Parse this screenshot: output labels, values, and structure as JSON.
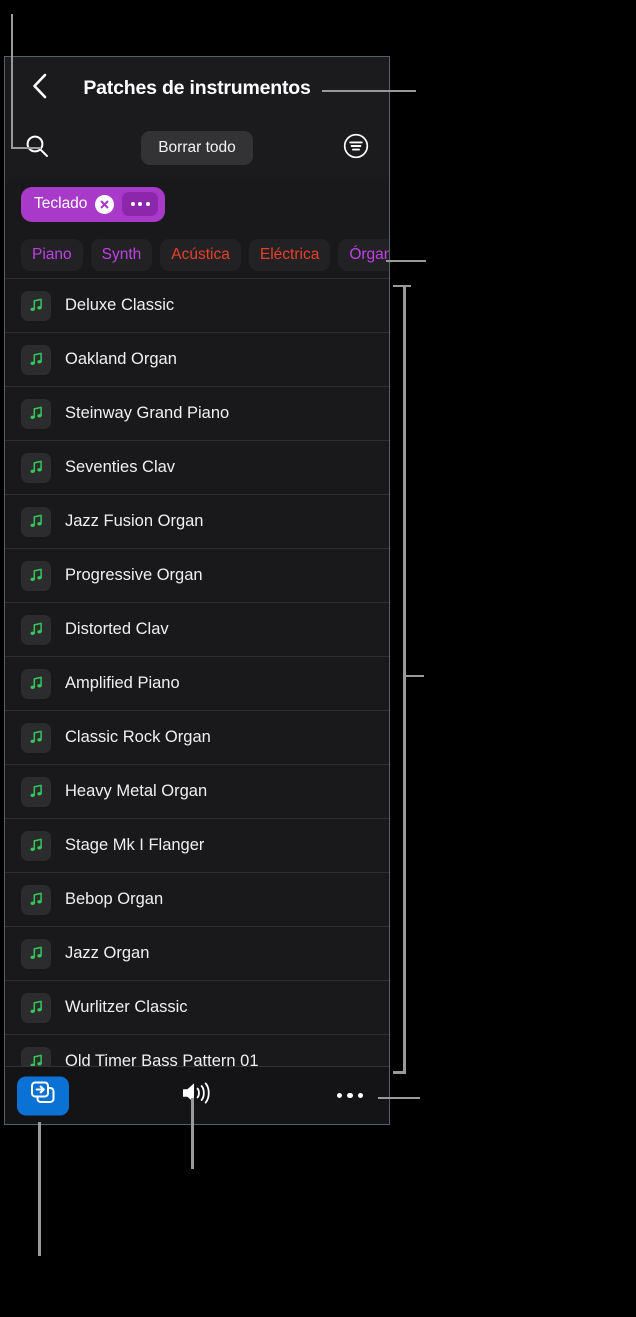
{
  "panel": {
    "title": "Patches de instrumentos",
    "back_icon": "chevron-left-icon"
  },
  "search_row": {
    "search_icon": "search-icon",
    "clear_all_label": "Borrar todo",
    "filter_icon": "filter-sort-icon"
  },
  "selected_tokens": [
    {
      "label": "Teclado",
      "remove_icon": "close-circle-icon",
      "more_icon": "ellipsis-icon",
      "color": "#A839C9",
      "more_color": "#8C27AB"
    }
  ],
  "category_chips": [
    {
      "label": "Piano",
      "color": "#C040E8"
    },
    {
      "label": "Synth",
      "color": "#C040E8"
    },
    {
      "label": "Acústica",
      "color": "#E8402A"
    },
    {
      "label": "Eléctrica",
      "color": "#E8402A"
    },
    {
      "label": "Órgano",
      "color": "#C040E8"
    }
  ],
  "patches": [
    {
      "name": "Deluxe Classic",
      "icon": "music-note-icon"
    },
    {
      "name": "Oakland Organ",
      "icon": "music-note-icon"
    },
    {
      "name": "Steinway Grand Piano",
      "icon": "music-note-icon"
    },
    {
      "name": "Seventies Clav",
      "icon": "music-note-icon"
    },
    {
      "name": "Jazz Fusion Organ",
      "icon": "music-note-icon"
    },
    {
      "name": "Progressive Organ",
      "icon": "music-note-icon"
    },
    {
      "name": "Distorted Clav",
      "icon": "music-note-icon"
    },
    {
      "name": "Amplified Piano",
      "icon": "music-note-icon"
    },
    {
      "name": "Classic Rock Organ",
      "icon": "music-note-icon"
    },
    {
      "name": "Heavy Metal Organ",
      "icon": "music-note-icon"
    },
    {
      "name": "Stage Mk I Flanger",
      "icon": "music-note-icon"
    },
    {
      "name": "Bebop Organ",
      "icon": "music-note-icon"
    },
    {
      "name": "Jazz Organ",
      "icon": "music-note-icon"
    },
    {
      "name": "Wurlitzer Classic",
      "icon": "music-note-icon"
    },
    {
      "name": "Old Timer Bass Pattern 01",
      "icon": "music-note-icon"
    }
  ],
  "toolbar": {
    "import_icon": "import-to-track-icon",
    "import_color": "#0A72D4",
    "speaker_icon": "speaker-wave-icon",
    "overflow_icon": "ellipsis-icon"
  },
  "theme": {
    "background": "#000000",
    "panel_background": "#1B1B1D",
    "list_background": "#19191B",
    "accent_green": "#34C759",
    "callout_line": "#9A9A9A"
  }
}
